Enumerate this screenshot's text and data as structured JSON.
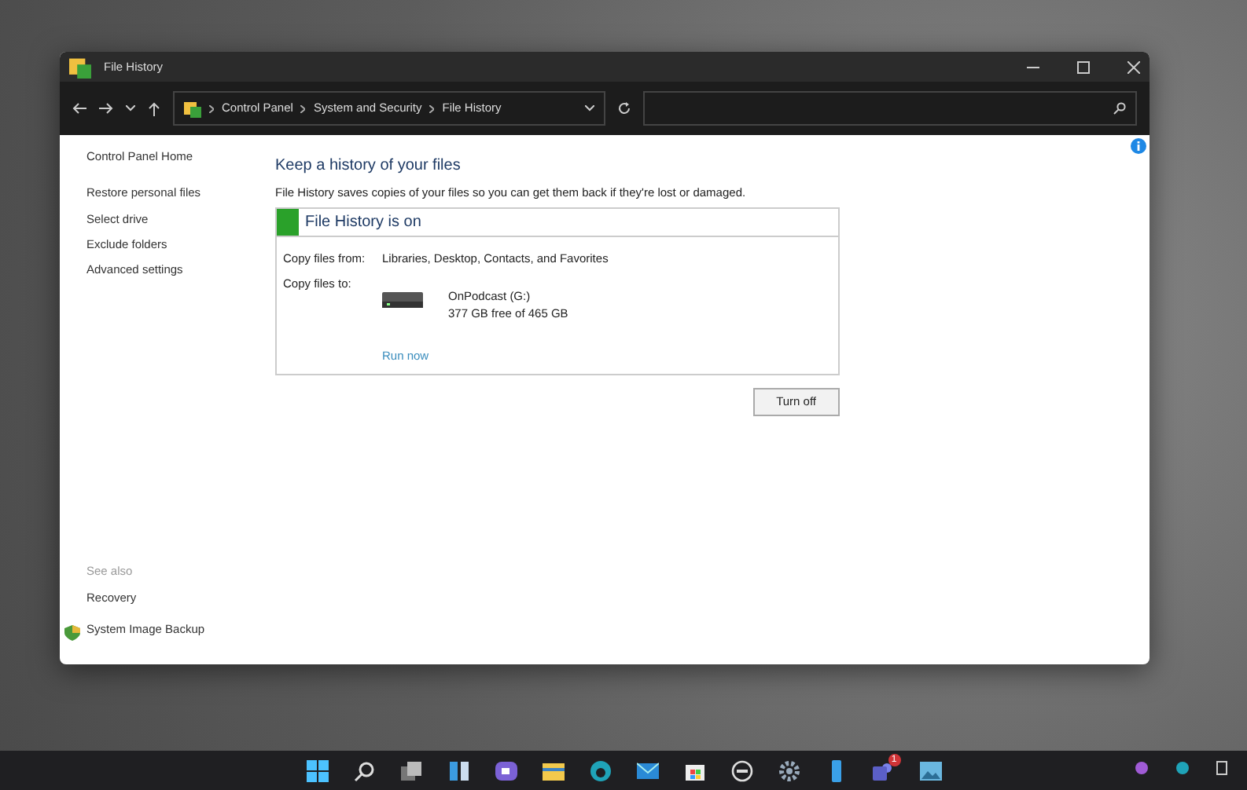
{
  "window": {
    "title": "File History"
  },
  "address_bar": {
    "path": [
      "Control Panel",
      "System and Security",
      "File History"
    ]
  },
  "sidebar": {
    "items": [
      {
        "label": "Control Panel Home",
        "kind": "home"
      },
      {
        "label": "Restore personal files",
        "kind": "link"
      },
      {
        "label": "Select drive",
        "kind": "link"
      },
      {
        "label": "Exclude folders",
        "kind": "link"
      },
      {
        "label": "Advanced settings",
        "kind": "link"
      }
    ],
    "see_also": {
      "heading": "See also",
      "items": [
        {
          "label": "Recovery",
          "kind": "plain"
        },
        {
          "label": "System Image Backup",
          "kind": "shield"
        }
      ]
    }
  },
  "main": {
    "heading": "Keep a history of your files",
    "description": "File History saves copies of your files so you can get them back if they're lost or damaged.",
    "status": {
      "title": "File History is on",
      "on": true
    },
    "copy_from": {
      "label": "Copy files from:",
      "value": "Libraries, Desktop, Contacts, and Favorites"
    },
    "copy_to": {
      "label": "Copy files to:",
      "drive_name": "OnPodcast (G:)",
      "drive_space": "377 GB free of 465 GB"
    },
    "run_now": "Run now",
    "turn_off_button": "Turn off"
  },
  "taskbar": {
    "chat_badge": "1"
  }
}
